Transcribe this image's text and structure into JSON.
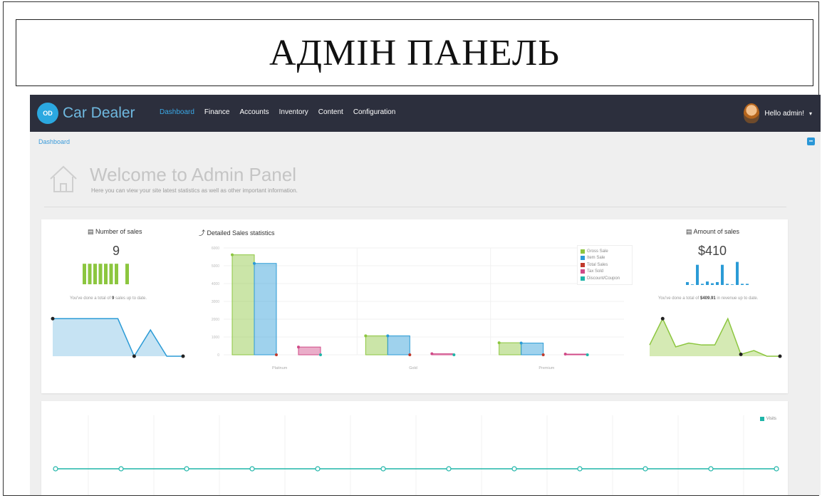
{
  "slide": {
    "title": "АДМІН ПАНЕЛЬ"
  },
  "navbar": {
    "brand_icon_text": "OD",
    "brand_name": "Car Dealer",
    "menu": [
      {
        "label": "Dashboard",
        "active": true
      },
      {
        "label": "Finance",
        "active": false
      },
      {
        "label": "Accounts",
        "active": false
      },
      {
        "label": "Inventory",
        "active": false
      },
      {
        "label": "Content",
        "active": false
      },
      {
        "label": "Configuration",
        "active": false
      }
    ],
    "user_greeting": "Hello admin!",
    "caret": "▾"
  },
  "breadcrumb": "Dashboard",
  "collapse_button": "▪▪",
  "welcome": {
    "title": "Welcome to Admin Panel",
    "subtitle": "Here you can view your site latest statistics as well as other important information."
  },
  "sales_count": {
    "title": "▤ Number of sales",
    "value": "9",
    "note_prefix": "You've done a total of ",
    "note_value": "9",
    "note_suffix": " sales up to date."
  },
  "detailed_stats": {
    "title": "⤴ Detailed Sales statistics"
  },
  "amount": {
    "title": "▤ Amount of sales",
    "value": "$410",
    "note_prefix": "You've done a total of ",
    "note_value": "$409.91",
    "note_suffix": " in revenue up to date."
  },
  "colors": {
    "green": "#8cc63f",
    "blue": "#2b9bd6",
    "red": "#c0392b",
    "pink": "#d04a87",
    "teal": "#1fb5a8",
    "nav_bg": "#2c2f3d",
    "accent": "#3aa8e6"
  },
  "trend_legend": "Visits",
  "chart_data": [
    {
      "type": "bar",
      "categories": [
        "Platinum",
        "Gold",
        "Premium"
      ],
      "series": [
        {
          "name": "Gross Sale",
          "values": [
            5800,
            1100,
            700
          ]
        },
        {
          "name": "Item Sale",
          "values": [
            5300,
            1100,
            680
          ]
        },
        {
          "name": "Total Sales",
          "values": [
            0,
            0,
            0
          ]
        },
        {
          "name": "Tax Sold",
          "values": [
            450,
            60,
            40
          ]
        },
        {
          "name": "Discount/Coupon",
          "values": [
            0,
            0,
            0
          ]
        }
      ],
      "y_ticks": [
        "6000",
        "5000",
        "4000",
        "3000",
        "2000",
        "1000",
        "0"
      ],
      "ylim": [
        0,
        6200
      ]
    },
    {
      "type": "bar",
      "name": "sales-count-sparkbars",
      "values": [
        9,
        9,
        9,
        9,
        9,
        9,
        9,
        0,
        9
      ],
      "ylim": [
        0,
        10
      ]
    },
    {
      "type": "bar",
      "name": "amount-sparkbars",
      "values": [
        0.5,
        0.1,
        3.5,
        0.2,
        0.6,
        0.3,
        0.5,
        3.5,
        0.2,
        0.1,
        4,
        0.2,
        0.2
      ],
      "ylim": [
        0,
        4.2
      ]
    },
    {
      "type": "area",
      "name": "sales-count-line",
      "values": [
        1,
        1,
        1,
        1,
        1,
        0,
        0.7,
        0,
        0
      ],
      "ylim": [
        0,
        1.1
      ]
    },
    {
      "type": "area",
      "name": "amount-line",
      "values": [
        0.3,
        1,
        0.25,
        0.35,
        0.3,
        0.3,
        1,
        0.05,
        0.15,
        0,
        0
      ],
      "ylim": [
        0,
        1.1
      ]
    },
    {
      "type": "line",
      "name": "visits-line",
      "values": [
        0,
        0,
        0,
        0,
        0,
        0,
        0,
        0,
        0,
        0,
        0,
        0
      ],
      "ylim": [
        0,
        1
      ]
    }
  ]
}
